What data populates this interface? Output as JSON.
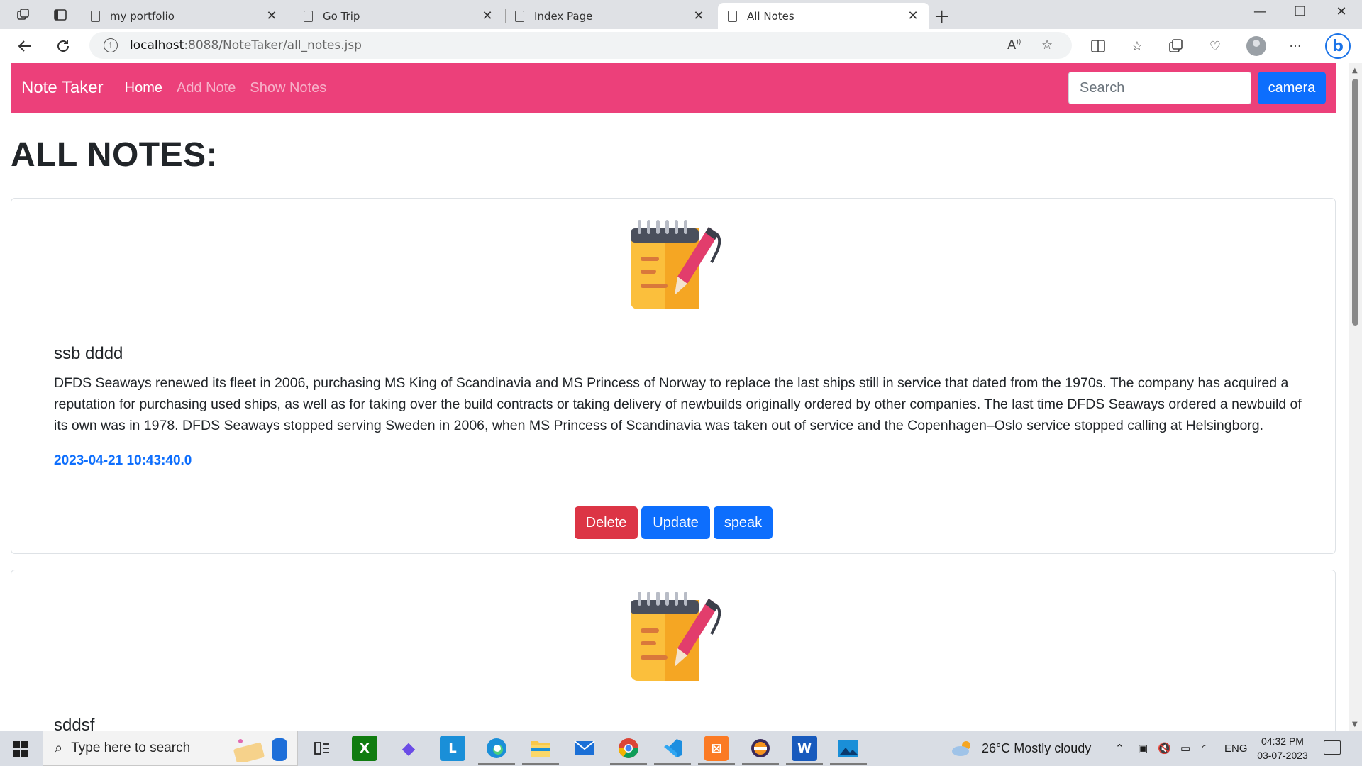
{
  "browser": {
    "tabs": [
      {
        "title": "my portfolio",
        "active": false
      },
      {
        "title": "Go Trip",
        "active": false
      },
      {
        "title": "Index Page",
        "active": false
      },
      {
        "title": "All Notes",
        "active": true
      }
    ],
    "url_host": "localhost",
    "url_rest": ":8088/NoteTaker/all_notes.jsp"
  },
  "navbar": {
    "brand": "Note Taker",
    "links": [
      "Home",
      "Add Note",
      "Show Notes"
    ],
    "search_placeholder": "Search",
    "camera_label": "camera",
    "color": "#ec407a"
  },
  "page": {
    "heading": "ALL NOTES:"
  },
  "notes": [
    {
      "title": "ssb dddd",
      "content": "DFDS Seaways renewed its fleet in 2006, purchasing MS King of Scandinavia and MS Princess of Norway to replace the last ships still in service that dated from the 1970s. The company has acquired a reputation for purchasing used ships, as well as for taking over the build contracts or taking delivery of newbuilds originally ordered by other companies. The last time DFDS Seaways ordered a newbuild of its own was in 1978. DFDS Seaways stopped serving Sweden in 2006, when MS Princess of Scandinavia was taken out of service and the Copenhagen–Oslo service stopped calling at Helsingborg.",
      "date": "2023-04-21 10:43:40.0",
      "buttons": {
        "delete": "Delete",
        "update": "Update",
        "speak": "speak"
      }
    },
    {
      "title": "sddsf"
    }
  ],
  "taskbar": {
    "search_placeholder": "Type here to search",
    "weather": "26°C  Mostly cloudy",
    "language": "ENG",
    "time": "04:32 PM",
    "date": "03-07-2023"
  }
}
